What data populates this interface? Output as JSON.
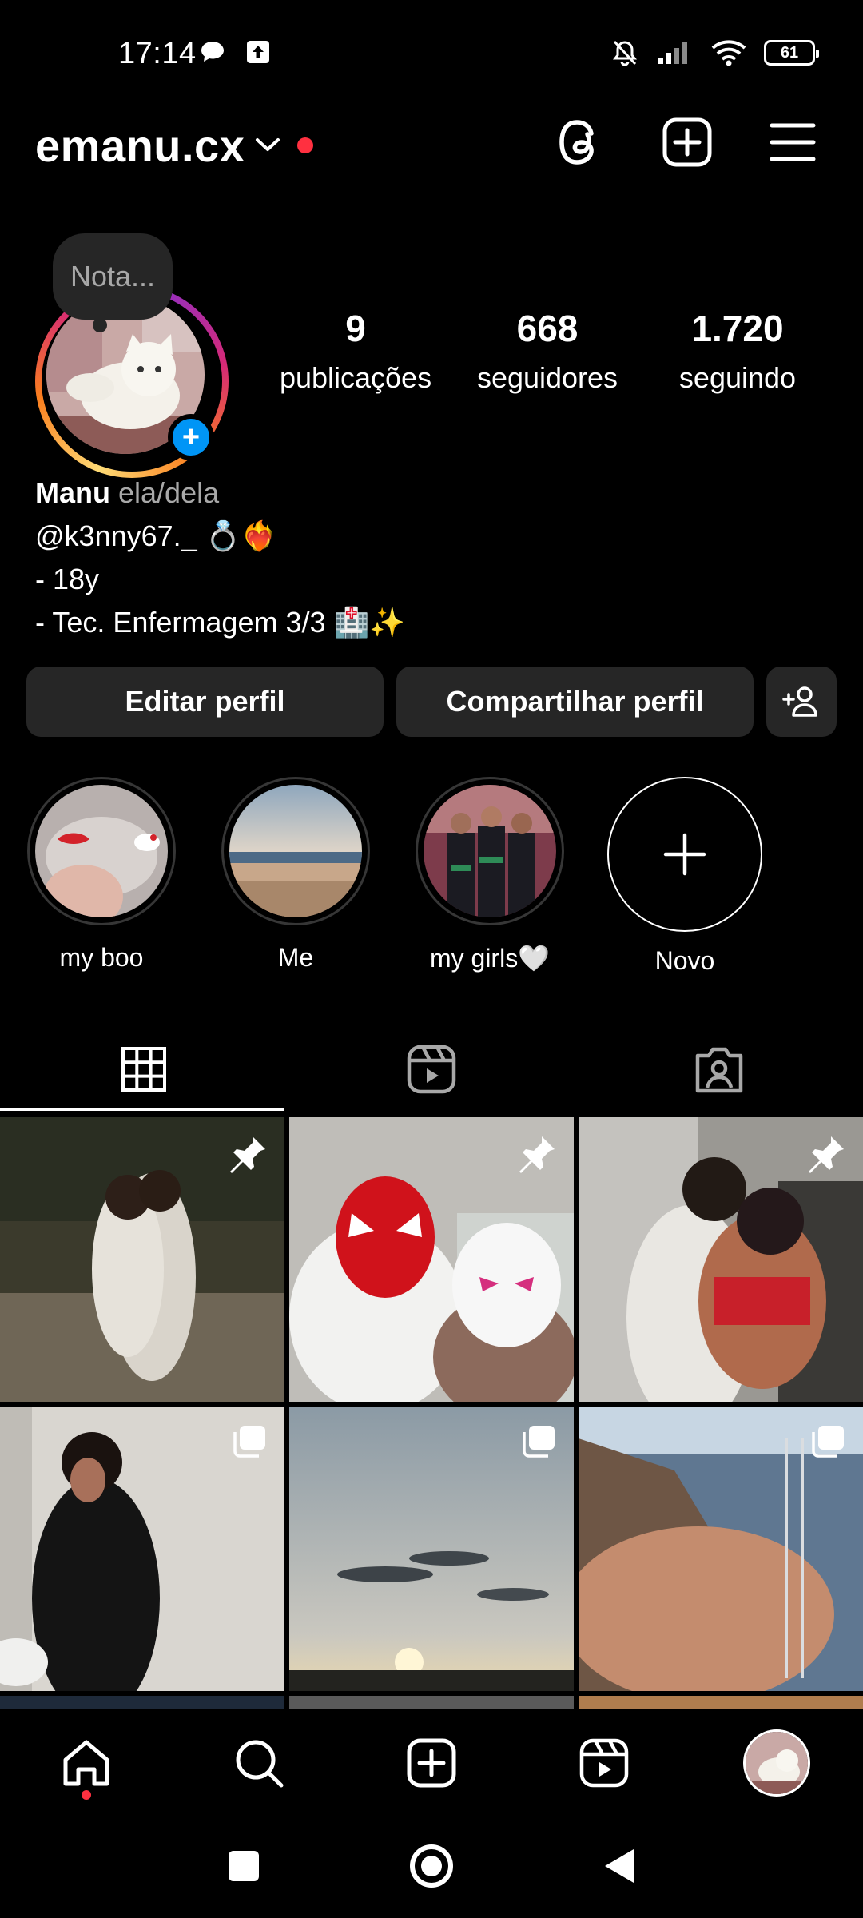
{
  "status_bar": {
    "time": "17:14",
    "battery": "61"
  },
  "header": {
    "username": "emanu.cx"
  },
  "profile": {
    "note": "Nota...",
    "stats": [
      {
        "value": "9",
        "label": "publicações"
      },
      {
        "value": "668",
        "label": "seguidores"
      },
      {
        "value": "1.720",
        "label": "seguindo"
      }
    ],
    "name": "Manu",
    "pronouns": "ela/dela",
    "bio_lines": [
      "@k3nny67._ 💍❤️‍🔥",
      "- 18y",
      "- Tec. Enfermagem 3/3 🏥✨"
    ]
  },
  "buttons": {
    "edit": "Editar perfil",
    "share": "Compartilhar perfil"
  },
  "highlights": [
    {
      "label": "my boo"
    },
    {
      "label": "Me"
    },
    {
      "label": "my girls🤍"
    },
    {
      "label": "Novo"
    }
  ],
  "tabs": {
    "active": "posts-grid"
  },
  "colors": {
    "accent": "#0095f6",
    "notification": "#ff3040",
    "surface": "#262626"
  },
  "icons": [
    "threads-icon",
    "create-icon",
    "menu-icon",
    "home-icon",
    "search-icon",
    "create-icon",
    "reels-icon",
    "pin-icon",
    "carousel-icon"
  ]
}
